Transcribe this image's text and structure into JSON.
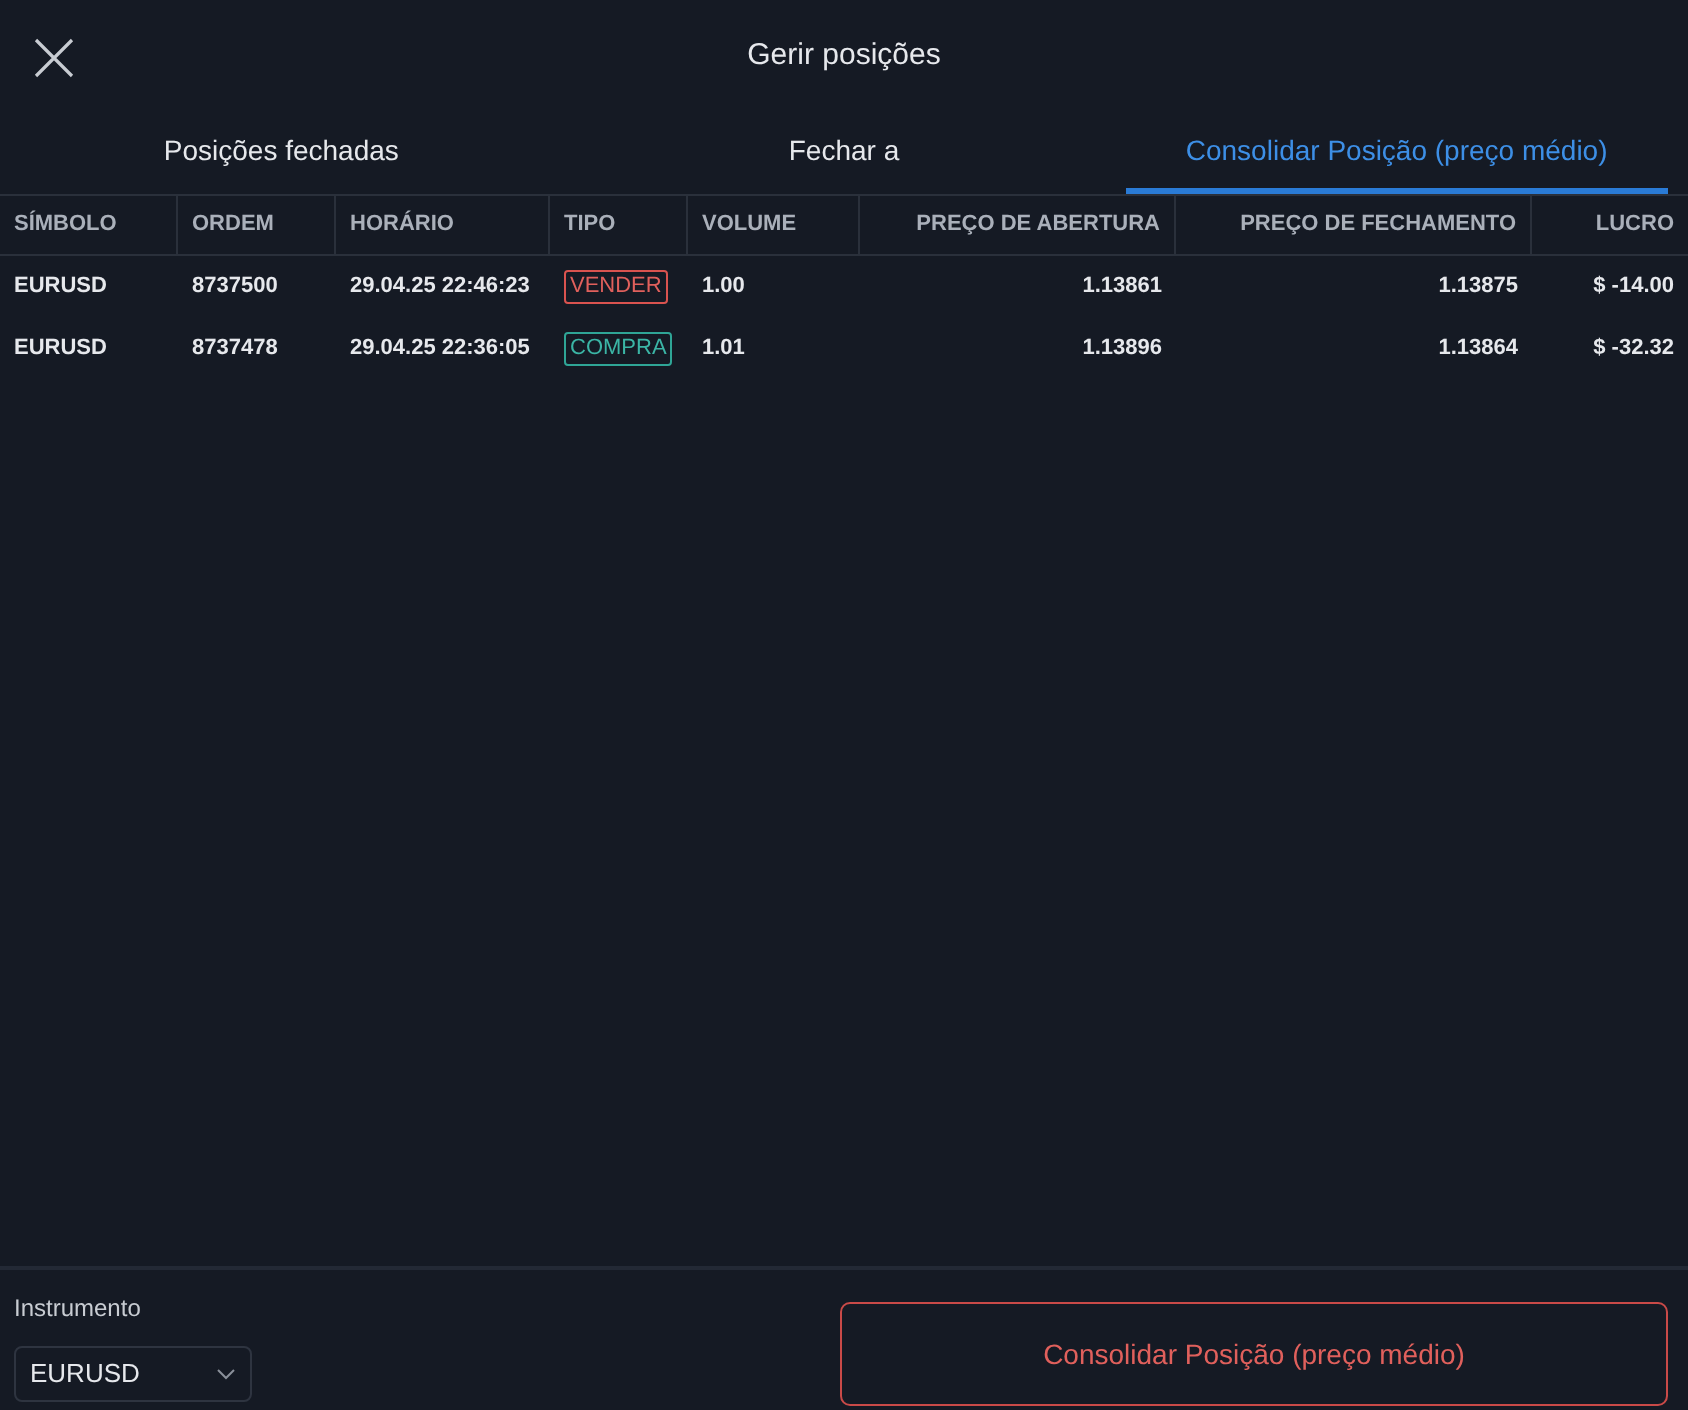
{
  "window": {
    "title": "Gerir posições"
  },
  "tabs": [
    {
      "label": "Posições fechadas",
      "selected": false
    },
    {
      "label": "Fechar a",
      "selected": false
    },
    {
      "label": "Consolidar Posição (preço médio)",
      "selected": true
    }
  ],
  "table": {
    "columns": [
      "SÍMBOLO",
      "ORDEM",
      "HORÁRIO",
      "TIPO",
      "VOLUME",
      "PREÇO DE ABERTURA",
      "PREÇO DE FECHAMENTO",
      "LUCRO"
    ],
    "rows": [
      {
        "symbol": "EURUSD",
        "order": "8737500",
        "time": "29.04.25 22:46:23",
        "type": {
          "label": "VENDER",
          "kind": "sell"
        },
        "volume": "1.00",
        "open": "1.13861",
        "close": "1.13875",
        "profit": "$ -14.00"
      },
      {
        "symbol": "EURUSD",
        "order": "8737478",
        "time": "29.04.25 22:36:05",
        "type": {
          "label": "COMPRA",
          "kind": "buy"
        },
        "volume": "1.01",
        "open": "1.13896",
        "close": "1.13864",
        "profit": "$ -32.32"
      }
    ]
  },
  "footer": {
    "instrument_label": "Instrumento",
    "instrument_value": "EURUSD",
    "button": "Consolidar Posição (preço médio)"
  }
}
